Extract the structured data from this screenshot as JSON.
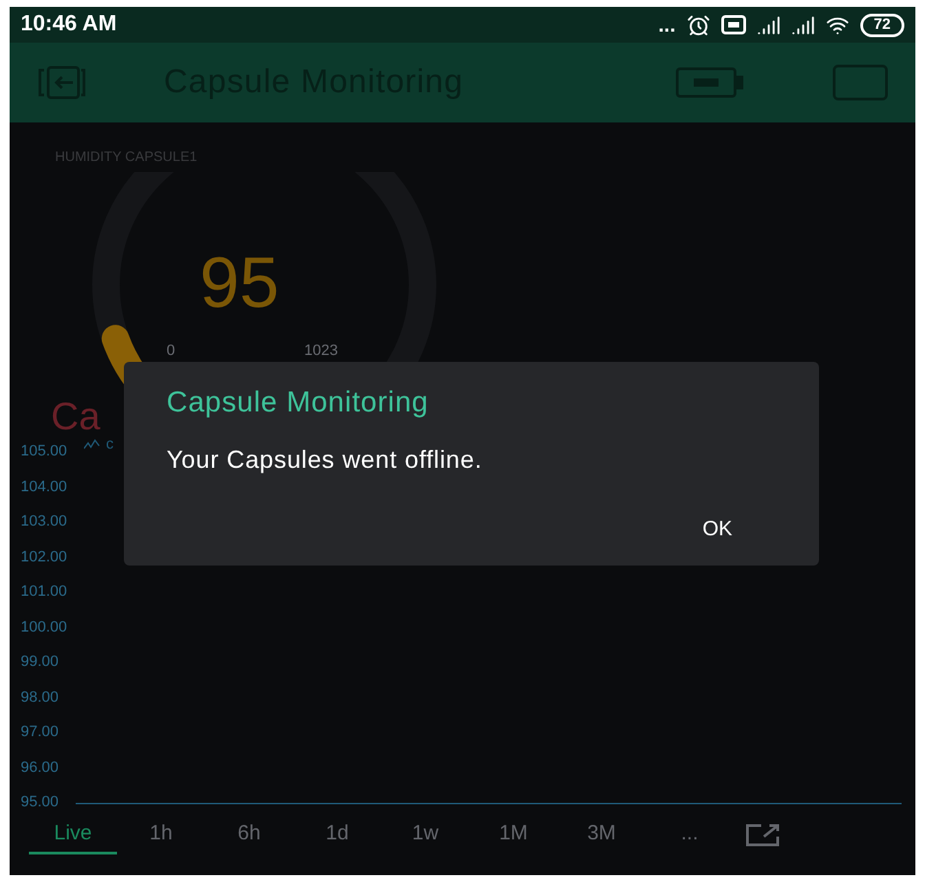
{
  "status_bar": {
    "time": "10:46 AM",
    "more": "...",
    "battery": "72"
  },
  "app_bar": {
    "title": "Capsule Monitoring"
  },
  "gauge": {
    "label": "HUMIDITY CAPSULE1",
    "value": "95",
    "min": "0",
    "max": "1023"
  },
  "chart": {
    "chart_data": {
      "type": "line",
      "categories": [
        null,
        null
      ],
      "series": [
        {
          "name": "c",
          "color": "#1f5a78",
          "values": [
            null,
            null
          ]
        }
      ],
      "title": "Ca",
      "ylim": [
        95,
        105
      ],
      "yticks": [
        {
          "value": 105,
          "label": "105.00"
        },
        {
          "value": 104,
          "label": "104.00"
        },
        {
          "value": 103,
          "label": "103.00"
        },
        {
          "value": 102,
          "label": "102.00"
        },
        {
          "value": 101,
          "label": "101.00"
        },
        {
          "value": 100,
          "label": "100.00"
        },
        {
          "value": 99,
          "label": "99.00"
        },
        {
          "value": 98,
          "label": "98.00"
        },
        {
          "value": 97,
          "label": "97.00"
        },
        {
          "value": 96,
          "label": "96.00"
        },
        {
          "value": 95,
          "label": "95.00"
        }
      ]
    }
  },
  "time_tabs": [
    {
      "label": "Live",
      "selected": true
    },
    {
      "label": "1h",
      "selected": false
    },
    {
      "label": "6h",
      "selected": false
    },
    {
      "label": "1d",
      "selected": false
    },
    {
      "label": "1w",
      "selected": false
    },
    {
      "label": "1M",
      "selected": false
    },
    {
      "label": "3M",
      "selected": false
    },
    {
      "label": "...",
      "selected": false
    }
  ],
  "dialog": {
    "title": "Capsule Monitoring",
    "message": "Your Capsules went offline.",
    "button": "OK"
  }
}
